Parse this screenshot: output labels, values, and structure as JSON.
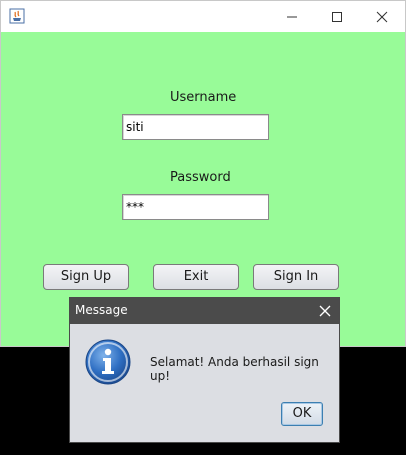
{
  "window": {
    "controls": [
      "minimize-icon",
      "maximize-icon",
      "close-icon"
    ]
  },
  "form": {
    "background": "#98fb98",
    "username_label": "Username",
    "username_value": "siti",
    "password_label": "Password",
    "password_value": "***",
    "buttons": {
      "signup": "Sign Up",
      "exit": "Exit",
      "signin": "Sign In"
    }
  },
  "dialog": {
    "title": "Message",
    "message": "Selamat! Anda berhasil sign up!",
    "ok_label": "OK",
    "icon": "info-icon"
  }
}
